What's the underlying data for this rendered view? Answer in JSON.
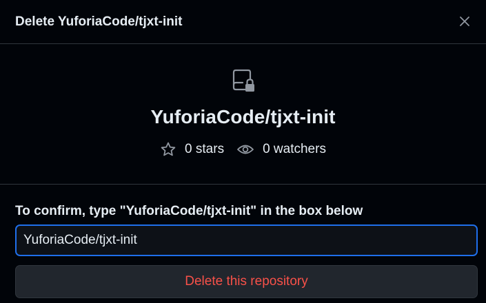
{
  "dialog": {
    "title": "Delete YuforiaCode/tjxt-init",
    "close_icon": "close-icon"
  },
  "repo": {
    "icon": "repo-locked-icon",
    "name": "YuforiaCode/tjxt-init",
    "stars_label": "0 stars",
    "watchers_label": "0 watchers"
  },
  "confirm": {
    "label": "To confirm, type \"YuforiaCode/tjxt-init\" in the box below",
    "input_value": "YuforiaCode/tjxt-init",
    "button_label": "Delete this repository"
  },
  "colors": {
    "background": "#010409",
    "border": "#30363d",
    "text": "#e6edf3",
    "muted_icon": "#9198a1",
    "focus_border": "#1f6feb",
    "danger": "#f85149",
    "button_bg": "#21262d"
  }
}
